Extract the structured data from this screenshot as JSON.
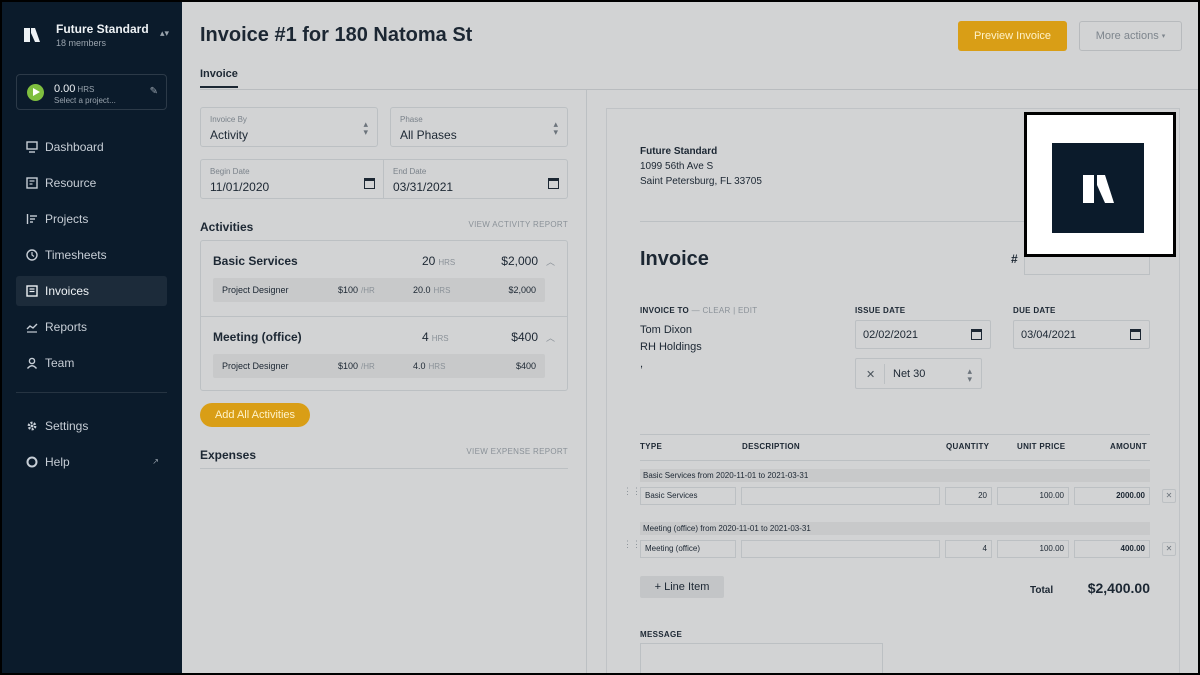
{
  "sidebar": {
    "org_name": "Future Standard",
    "org_members": "18 members",
    "timer": {
      "hours": "0.00",
      "unit": "HRS",
      "project_placeholder": "Select a project..."
    },
    "nav": [
      {
        "label": "Dashboard",
        "icon": "monitor-icon"
      },
      {
        "label": "Resource",
        "icon": "resource-icon"
      },
      {
        "label": "Projects",
        "icon": "projects-icon"
      },
      {
        "label": "Timesheets",
        "icon": "clock-icon"
      },
      {
        "label": "Invoices",
        "icon": "invoice-icon",
        "active": true
      },
      {
        "label": "Reports",
        "icon": "chart-line-icon"
      },
      {
        "label": "Team",
        "icon": "person-icon"
      }
    ],
    "bottom_nav": [
      {
        "label": "Settings",
        "icon": "gear-icon"
      },
      {
        "label": "Help",
        "icon": "help-icon"
      }
    ]
  },
  "header": {
    "title": "Invoice #1 for 180 Natoma St",
    "preview_button": "Preview Invoice",
    "more_actions": "More actions"
  },
  "tabs": {
    "invoice": "Invoice"
  },
  "filters": {
    "invoice_by": {
      "label": "Invoice By",
      "value": "Activity"
    },
    "phase": {
      "label": "Phase",
      "value": "All Phases"
    },
    "begin_date": {
      "label": "Begin Date",
      "value": "11/01/2020"
    },
    "end_date": {
      "label": "End Date",
      "value": "03/31/2021"
    }
  },
  "activities": {
    "title": "Activities",
    "report_link": "VIEW ACTIVITY REPORT",
    "items": [
      {
        "name": "Basic Services",
        "hours": "20",
        "amount": "$2,000",
        "role": "Project Designer",
        "rate": "$100",
        "role_hours": "20.0",
        "role_amount": "$2,000"
      },
      {
        "name": "Meeting (office)",
        "hours": "4",
        "amount": "$400",
        "role": "Project Designer",
        "rate": "$100",
        "role_hours": "4.0",
        "role_amount": "$400"
      }
    ],
    "hrs_unit": "HRS",
    "rate_unit": "/HR",
    "add_all": "Add All Activities"
  },
  "expenses": {
    "title": "Expenses",
    "report_link": "VIEW EXPENSE REPORT"
  },
  "invoice": {
    "from_name": "Future Standard",
    "from_address1": "1099 56th Ave S",
    "from_address2": "Saint Petersburg, FL 33705",
    "heading": "Invoice",
    "number_label": "#",
    "invoice_to_label": "INVOICE TO",
    "clear_edit": "— CLEAR | EDIT",
    "to_name": "Tom Dixon",
    "to_company": "RH Holdings",
    "to_extra": ",",
    "issue_date_label": "ISSUE DATE",
    "issue_date": "02/02/2021",
    "due_date_label": "DUE DATE",
    "due_date": "03/04/2021",
    "terms": "Net 30",
    "columns": {
      "type": "TYPE",
      "description": "DESCRIPTION",
      "quantity": "QUANTITY",
      "unit_price": "UNIT PRICE",
      "amount": "AMOUNT"
    },
    "line_items": [
      {
        "caption": "Basic Services from 2020-11-01 to 2021-03-31",
        "type": "Basic Services",
        "quantity": "20",
        "unit_price": "100.00",
        "amount": "2000.00"
      },
      {
        "caption": "Meeting (office) from 2020-11-01 to 2021-03-31",
        "type": "Meeting (office)",
        "quantity": "4",
        "unit_price": "100.00",
        "amount": "400.00"
      }
    ],
    "add_line": "+  Line Item",
    "total_label": "Total",
    "total_value": "$2,400.00",
    "message_label": "MESSAGE"
  }
}
